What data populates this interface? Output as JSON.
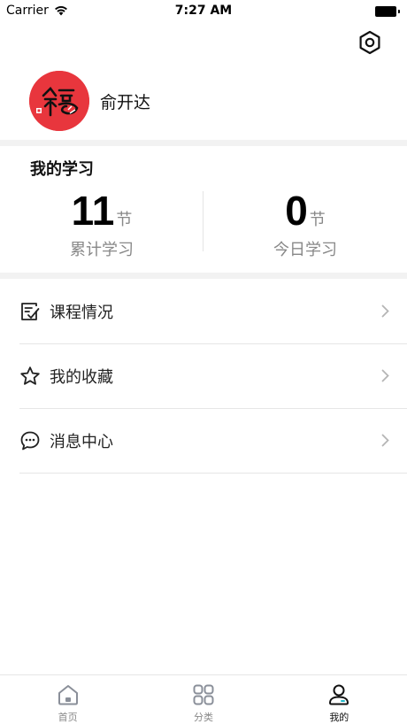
{
  "status_bar": {
    "carrier": "Carrier",
    "time": "7:27 AM"
  },
  "profile": {
    "name": "俞开达"
  },
  "study": {
    "title": "我的学习",
    "total": {
      "value": "11",
      "unit": "节",
      "label": "累计学习"
    },
    "today": {
      "value": "0",
      "unit": "节",
      "label": "今日学习"
    }
  },
  "menu": {
    "items": [
      {
        "label": "课程情况",
        "icon": "course-checklist-icon"
      },
      {
        "label": "我的收藏",
        "icon": "star-icon"
      },
      {
        "label": "消息中心",
        "icon": "chat-bubble-icon"
      }
    ]
  },
  "tabs": [
    {
      "label": "首页",
      "icon": "home-icon",
      "active": false
    },
    {
      "label": "分类",
      "icon": "category-icon",
      "active": false
    },
    {
      "label": "我的",
      "icon": "profile-icon",
      "active": true
    }
  ],
  "colors": {
    "avatar_bg": "#e8363d",
    "tab_accent": "#1fb8c8"
  }
}
